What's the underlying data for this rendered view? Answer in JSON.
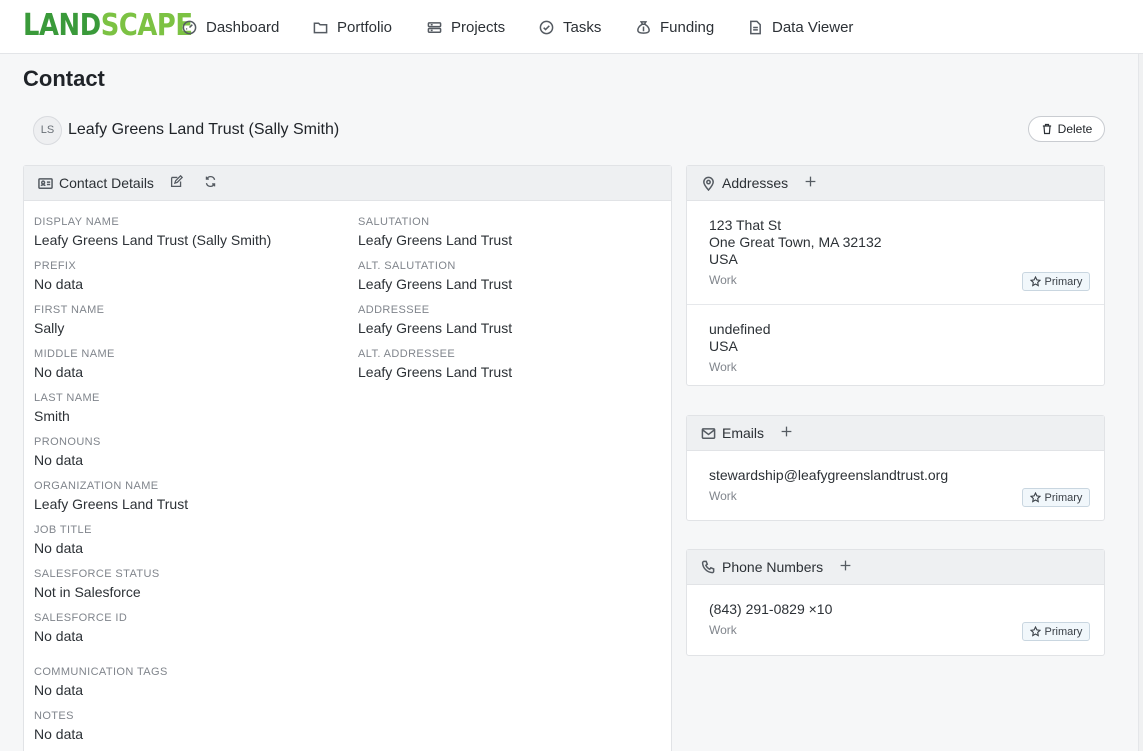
{
  "app": {
    "logo_text_a": "LAND",
    "logo_text_b": "SCAPE"
  },
  "nav": [
    {
      "label": "Dashboard",
      "icon": "gauge-icon"
    },
    {
      "label": "Portfolio",
      "icon": "folder-icon"
    },
    {
      "label": "Projects",
      "icon": "projects-icon"
    },
    {
      "label": "Tasks",
      "icon": "check-circle-icon"
    },
    {
      "label": "Funding",
      "icon": "money-bag-icon"
    },
    {
      "label": "Data Viewer",
      "icon": "document-icon"
    }
  ],
  "page": {
    "title": "Contact",
    "avatar_initials": "LS",
    "contact_name": "Leafy Greens Land Trust (Sally Smith)",
    "delete_label": "Delete"
  },
  "details": {
    "title": "Contact Details",
    "left": [
      {
        "label": "Display Name",
        "value": "Leafy Greens Land Trust (Sally Smith)"
      },
      {
        "label": "Prefix",
        "value": "No data"
      },
      {
        "label": "First Name",
        "value": "Sally"
      },
      {
        "label": "Middle Name",
        "value": "No data"
      },
      {
        "label": "Last Name",
        "value": "Smith"
      },
      {
        "label": "Pronouns",
        "value": "No data"
      },
      {
        "label": "Organization Name",
        "value": "Leafy Greens Land Trust"
      },
      {
        "label": "Job Title",
        "value": "No data"
      },
      {
        "label": "Salesforce Status",
        "value": "Not in Salesforce"
      },
      {
        "label": "Salesforce ID",
        "value": "No data"
      },
      {
        "label": "Communication Tags",
        "value": "No data"
      },
      {
        "label": "Notes",
        "value": "No data"
      }
    ],
    "right": [
      {
        "label": "Salutation",
        "value": "Leafy Greens Land Trust"
      },
      {
        "label": "Alt. Salutation",
        "value": "Leafy Greens Land Trust"
      },
      {
        "label": "Addressee",
        "value": "Leafy Greens Land Trust"
      },
      {
        "label": "Alt. Addressee",
        "value": "Leafy Greens Land Trust"
      }
    ]
  },
  "addresses": {
    "title": "Addresses",
    "items": [
      {
        "line1": "123 That St",
        "line2": "One Great Town, MA 32132",
        "line3": "USA",
        "type": "Work",
        "primary": "Primary"
      },
      {
        "line1": "undefined",
        "line2": "USA",
        "type": "Work"
      }
    ]
  },
  "emails": {
    "title": "Emails",
    "items": [
      {
        "value": "stewardship@leafygreenslandtrust.org",
        "type": "Work",
        "primary": "Primary"
      }
    ]
  },
  "phones": {
    "title": "Phone Numbers",
    "items": [
      {
        "value": "(843) 291-0829 ×10",
        "type": "Work",
        "primary": "Primary"
      }
    ]
  }
}
